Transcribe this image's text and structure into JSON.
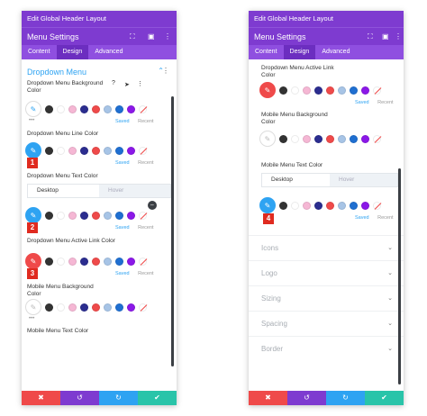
{
  "colors": {
    "purple": "#7e3bd0",
    "blue": "#2ea3f2",
    "red": "#ef4a4a",
    "green": "#29c4a9"
  },
  "swatches": [
    "#333333",
    "#ffffff",
    "#f5b7d4",
    "#2b2d8f",
    "#ef4a4a",
    "#a7c4e6",
    "#1f6fd1",
    "#8b18e8"
  ],
  "left": {
    "window_title": "Edit Global Header Layout",
    "panel_title": "Menu Settings",
    "tabs": [
      "Content",
      "Design",
      "Advanced"
    ],
    "section": "Dropdown Menu",
    "labels": {
      "bg": "Dropdown Menu Background Color",
      "line": "Dropdown Menu Line Color",
      "text": "Dropdown Menu Text Color",
      "active": "Dropdown Menu Active Link Color",
      "mobile_bg": "Mobile Menu Background Color",
      "mobile_text": "Mobile Menu Text Color"
    },
    "toggle": [
      "Desktop",
      "Hover"
    ],
    "saved": "Saved",
    "recent": "Recent",
    "badges": [
      "1",
      "2",
      "3"
    ]
  },
  "right": {
    "window_title": "Edit Global Header Layout",
    "panel_title": "Menu Settings",
    "tabs": [
      "Content",
      "Design",
      "Advanced"
    ],
    "labels": {
      "active": "Dropdown Menu Active Link Color",
      "mobile_bg": "Mobile Menu Background Color",
      "mobile_text": "Mobile Menu Text Color"
    },
    "toggle": [
      "Desktop",
      "Hover"
    ],
    "saved": "Saved",
    "recent": "Recent",
    "badge": "4",
    "collapsed": [
      "Icons",
      "Logo",
      "Sizing",
      "Spacing",
      "Border"
    ]
  },
  "footer_icons": {
    "close": "✖",
    "undo": "↺",
    "redo": "↻",
    "save": "✔"
  }
}
